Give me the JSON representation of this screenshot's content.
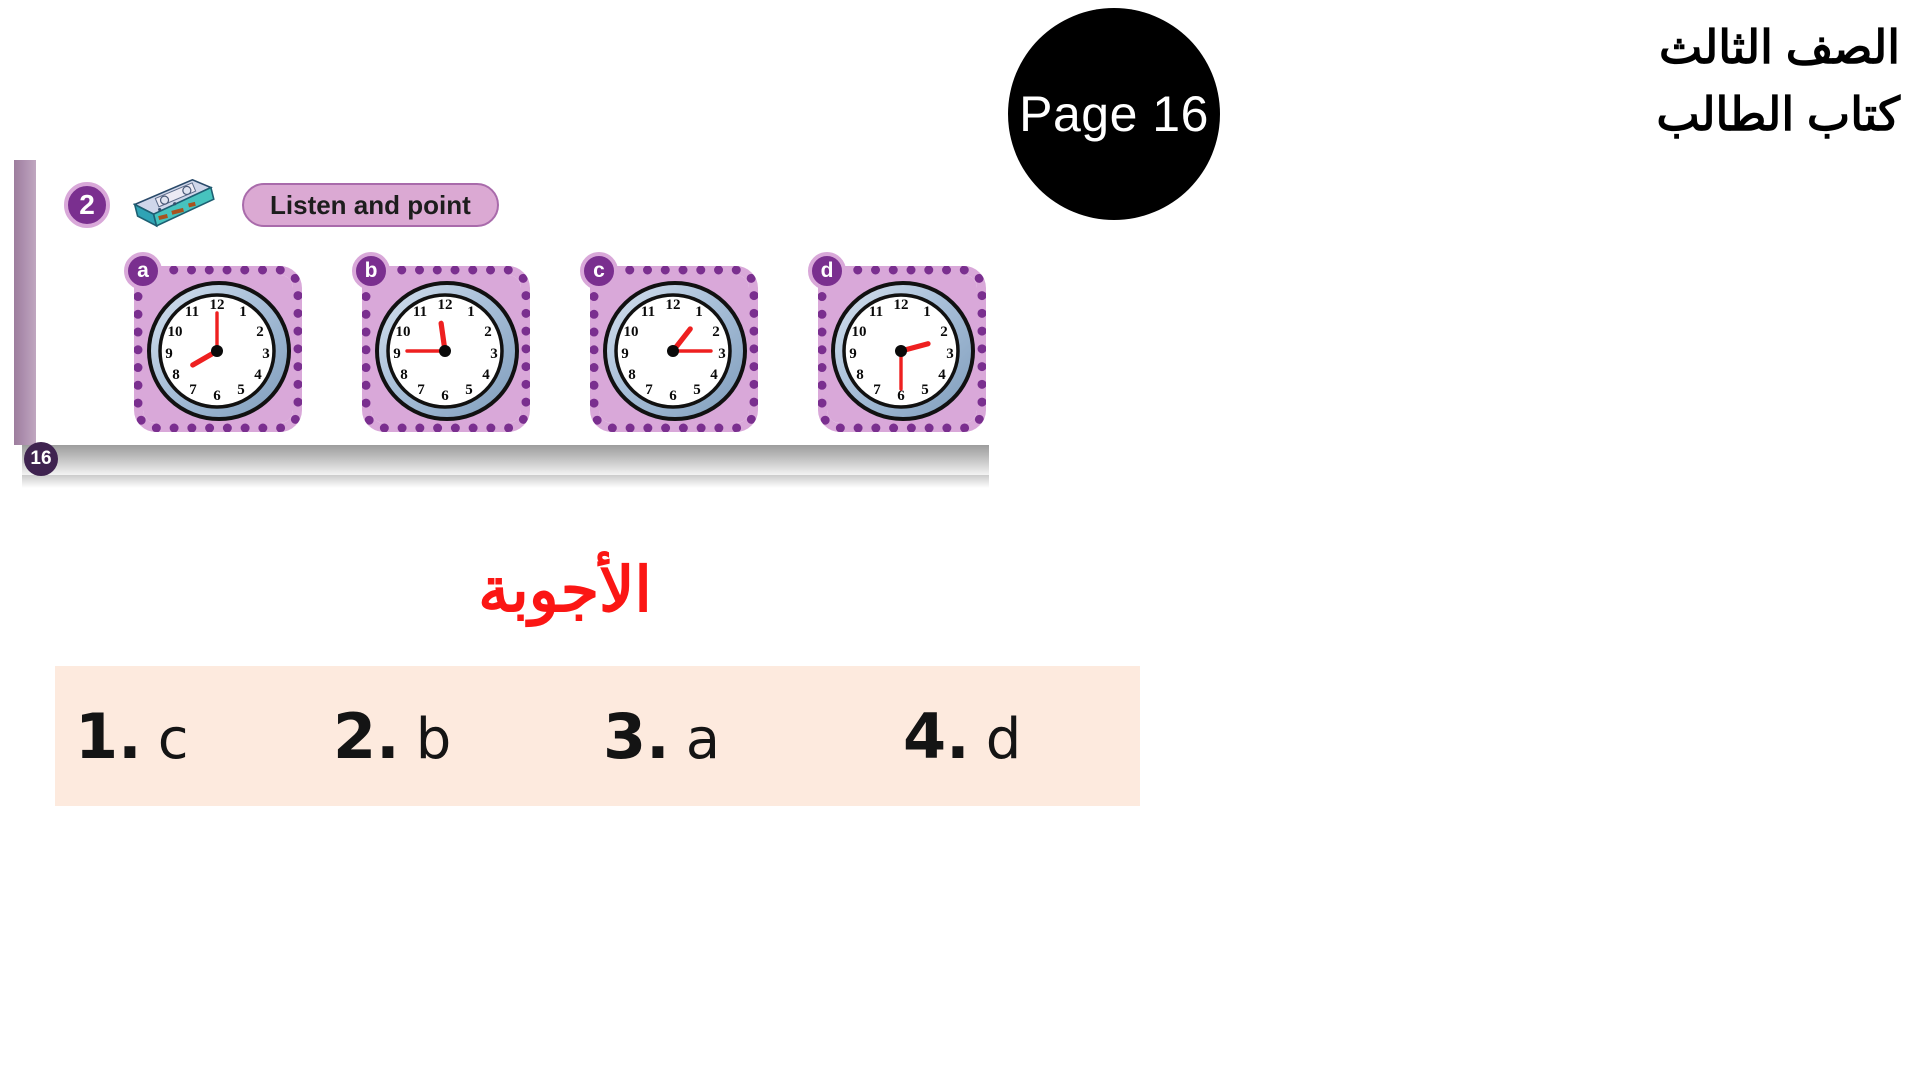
{
  "header": {
    "page_badge": "Page 16",
    "title_line1": "الصف الثالث",
    "title_line2": "كتاب الطالب"
  },
  "worksheet": {
    "page_number": "16",
    "task": {
      "number": "2",
      "audio_icon": "cassette-tape-icon",
      "instruction": "Listen and point"
    },
    "clocks": [
      {
        "letter": "a",
        "time": "8:00",
        "hour_deg": 240,
        "minute_deg": 0
      },
      {
        "letter": "b",
        "time": "11:45",
        "hour_deg": 352,
        "minute_deg": 270
      },
      {
        "letter": "c",
        "time": "1:15",
        "hour_deg": 38,
        "minute_deg": 90
      },
      {
        "letter": "d",
        "time": "2:30",
        "hour_deg": 75,
        "minute_deg": 180
      }
    ],
    "clock_numerals": [
      "12",
      "1",
      "2",
      "3",
      "4",
      "5",
      "6",
      "7",
      "8",
      "9",
      "10",
      "11"
    ]
  },
  "answers": {
    "title": "الأجوبة",
    "items": [
      {
        "number": "1.",
        "value": "c"
      },
      {
        "number": "2.",
        "value": "b"
      },
      {
        "number": "3.",
        "value": "a"
      },
      {
        "number": "4.",
        "value": "d"
      }
    ]
  },
  "colors": {
    "purple": "#7a2f8f",
    "pink": "#d9a8d9",
    "pill_bg": "#dba9d3",
    "answer_red": "#fb1614",
    "answer_strip_bg": "#fdeade",
    "clock_rim": "#a9c0d9",
    "hand_red": "#ee2020"
  }
}
